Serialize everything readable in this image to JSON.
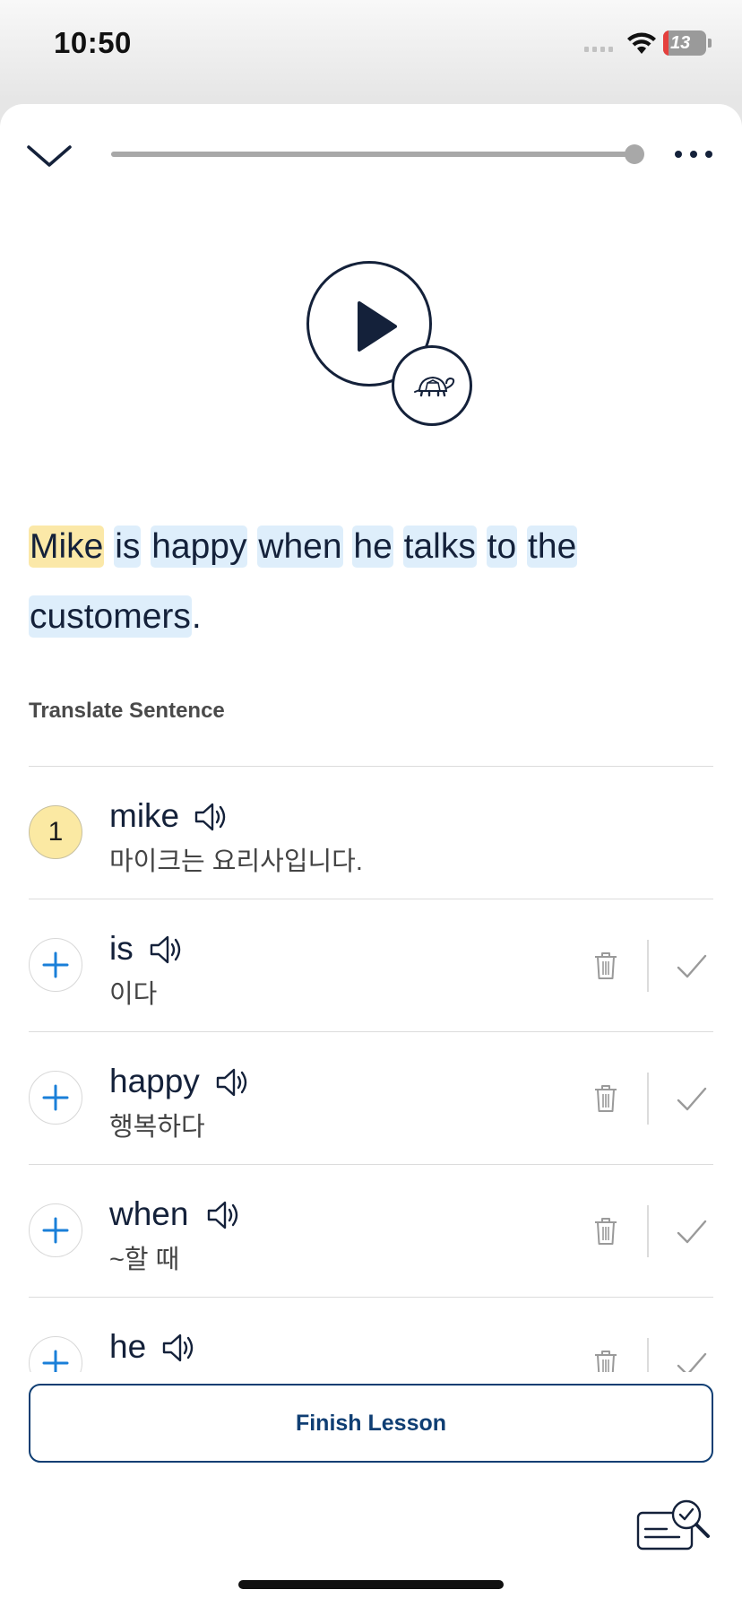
{
  "status_bar": {
    "time": "10:50",
    "battery_level": "13",
    "battery_fraction": 0.13
  },
  "player": {
    "progress": 1.0,
    "play_icon": "play-icon",
    "slow_icon": "turtle-icon"
  },
  "sentence": {
    "words": [
      {
        "text": "Mike",
        "status": "known"
      },
      {
        "text": "is",
        "status": "new"
      },
      {
        "text": "happy",
        "status": "new"
      },
      {
        "text": "when",
        "status": "new"
      },
      {
        "text": "he",
        "status": "new"
      },
      {
        "text": "talks",
        "status": "new"
      },
      {
        "text": "to",
        "status": "new"
      },
      {
        "text": "the",
        "status": "new"
      },
      {
        "text": "customers",
        "status": "new"
      }
    ],
    "end_punctuation": "."
  },
  "translate_label": "Translate Sentence",
  "vocab": [
    {
      "term": "mike",
      "meaning": "마이크는 요리사입니다.",
      "level": "1",
      "state": "known"
    },
    {
      "term": "is",
      "meaning": "이다",
      "level": "",
      "state": "new"
    },
    {
      "term": "happy",
      "meaning": "행복하다",
      "level": "",
      "state": "new"
    },
    {
      "term": "when",
      "meaning": "~할 때",
      "level": "",
      "state": "new"
    },
    {
      "term": "he",
      "meaning": "",
      "level": "",
      "state": "new"
    }
  ],
  "finish_button": "Finish Lesson",
  "colors": {
    "known_highlight": "#fbe8a8",
    "new_highlight": "#deeefb",
    "accent_blue": "#1a7fd8",
    "navy": "#0f3e73"
  }
}
